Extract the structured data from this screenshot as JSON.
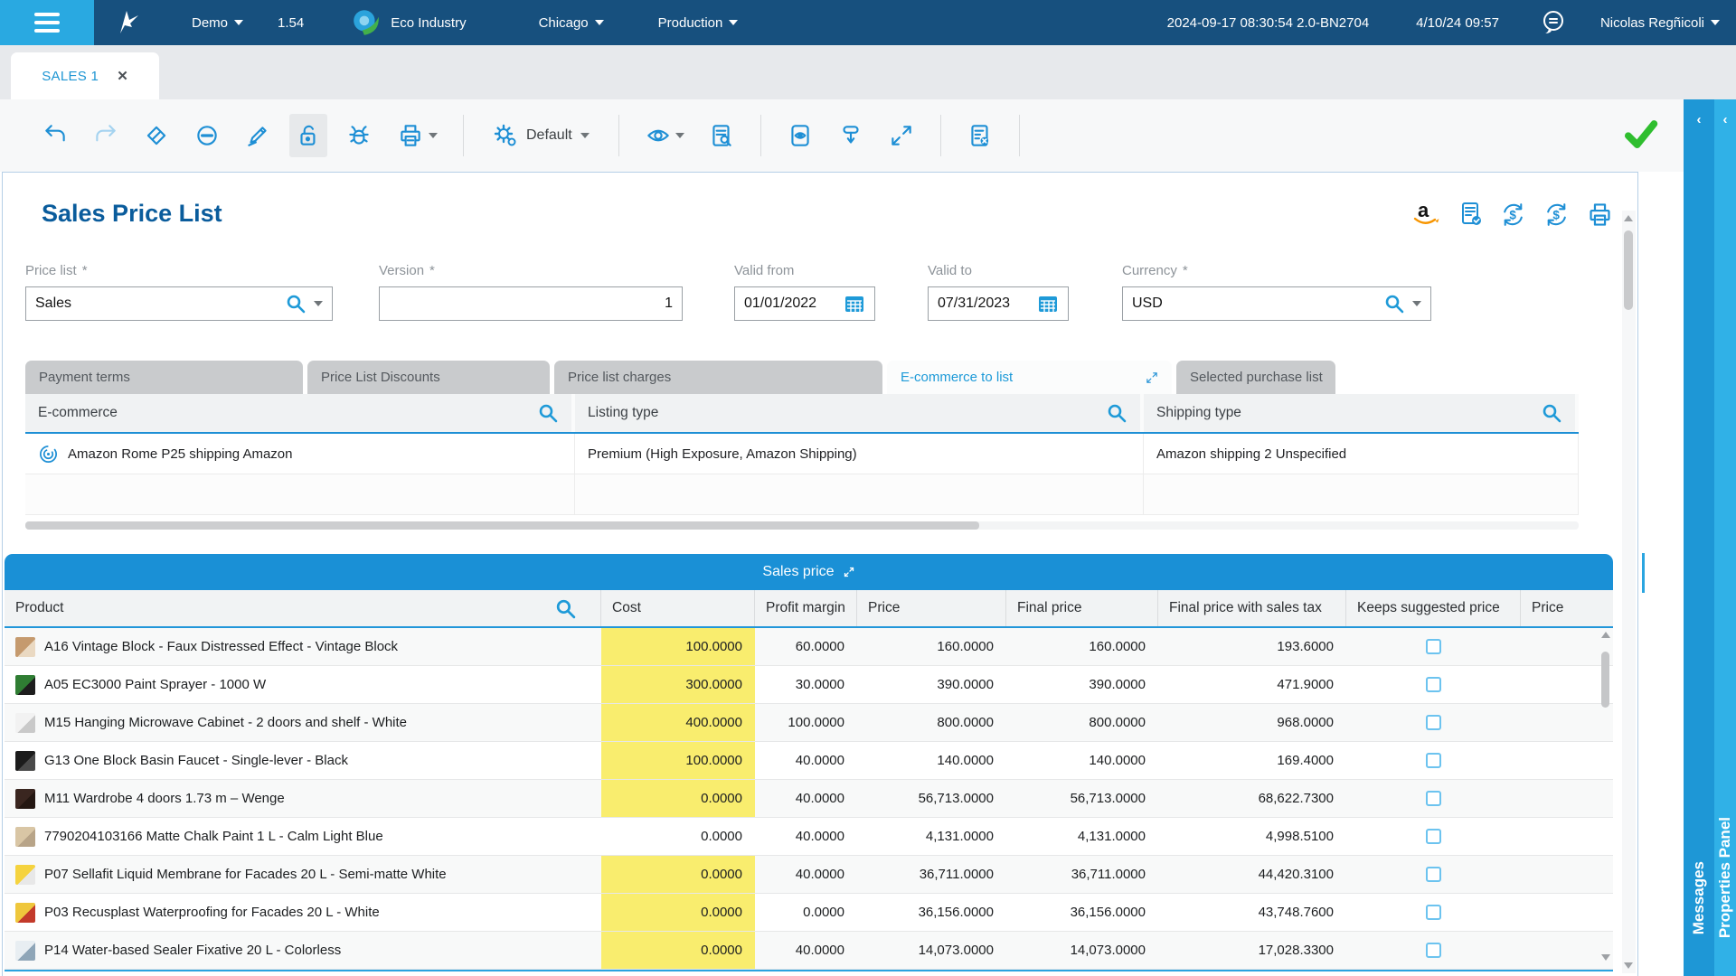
{
  "colors": {
    "accent_blue": "#1e8fd5",
    "topbar_navy": "#17507e",
    "light_blue": "#29a9e1",
    "highlight_yellow": "#f9ed6e",
    "success_green": "#2fbe2f",
    "amazon_orange": "#f79500"
  },
  "topbar": {
    "env": "Demo",
    "version": "1.54",
    "company": "Eco Industry",
    "branch": "Chicago",
    "mode": "Production",
    "build_info": "2024-09-17 08:30:54 2.0-BN2704",
    "session_time": "4/10/24 09:57",
    "user": "Nicolas Regñicoli"
  },
  "window_tab": {
    "label": "SALES 1",
    "close": "✕"
  },
  "toolbar": {
    "view_profile": "Default"
  },
  "page": {
    "title": "Sales Price List"
  },
  "form": {
    "price_list": {
      "label": "Price list",
      "required": "*",
      "value": "Sales"
    },
    "version": {
      "label": "Version",
      "required": "*",
      "value": "1"
    },
    "valid_from": {
      "label": "Valid from",
      "required": "",
      "value": "01/01/2022"
    },
    "valid_to": {
      "label": "Valid to",
      "required": "",
      "value": "07/31/2023"
    },
    "currency": {
      "label": "Currency",
      "required": "*",
      "value": "USD"
    }
  },
  "subtabs": [
    {
      "label": "Payment terms",
      "active": false
    },
    {
      "label": "Price List Discounts",
      "active": false
    },
    {
      "label": "Price list charges",
      "active": false
    },
    {
      "label": "E-commerce to list",
      "active": true
    },
    {
      "label": "Selected purchase list",
      "active": false
    }
  ],
  "ecommerce_table": {
    "columns": [
      "E-commerce",
      "Listing type",
      "Shipping type"
    ],
    "rows": [
      {
        "ecommerce": "Amazon Rome P25 shipping Amazon",
        "listing_type": "Premium (High Exposure, Amazon Shipping)",
        "shipping_type": "Amazon shipping 2 Unspecified"
      }
    ]
  },
  "sales_table": {
    "title": "Sales price",
    "columns": [
      "Product",
      "Cost",
      "Profit margin",
      "Price",
      "Final price",
      "Final price with sales tax",
      "Keeps suggested price",
      "Price"
    ],
    "rows": [
      {
        "product": "A16 Vintage Block - Faux Distressed Effect - Vintage Block",
        "cost": "100.0000",
        "profit_margin": "60.0000",
        "price": "160.0000",
        "final_price": "160.0000",
        "final_price_tax": "193.6000",
        "keeps_suggested": false,
        "cost_highlight": true,
        "thumb": [
          "#c59a6e",
          "#ead9c2"
        ]
      },
      {
        "product": "A05 EC3000 Paint Sprayer - 1000 W",
        "cost": "300.0000",
        "profit_margin": "30.0000",
        "price": "390.0000",
        "final_price": "390.0000",
        "final_price_tax": "471.9000",
        "keeps_suggested": false,
        "cost_highlight": true,
        "thumb": [
          "#2f7d33",
          "#1d1d1d"
        ]
      },
      {
        "product": "M15 Hanging Microwave Cabinet - 2 doors and shelf - White",
        "cost": "400.0000",
        "profit_margin": "100.0000",
        "price": "800.0000",
        "final_price": "800.0000",
        "final_price_tax": "968.0000",
        "keeps_suggested": false,
        "cost_highlight": true,
        "thumb": [
          "#f2f2f2",
          "#c9c9c9"
        ]
      },
      {
        "product": "G13 One Block Basin Faucet - Single-lever - Black",
        "cost": "100.0000",
        "profit_margin": "40.0000",
        "price": "140.0000",
        "final_price": "140.0000",
        "final_price_tax": "169.4000",
        "keeps_suggested": false,
        "cost_highlight": true,
        "thumb": [
          "#1c1c1c",
          "#4a4a4a"
        ]
      },
      {
        "product": "M11 Wardrobe 4 doors 1.73 m – Wenge",
        "cost": "0.0000",
        "profit_margin": "40.0000",
        "price": "56,713.0000",
        "final_price": "56,713.0000",
        "final_price_tax": "68,622.7300",
        "keeps_suggested": false,
        "cost_highlight": true,
        "thumb": [
          "#3a2620",
          "#241712"
        ]
      },
      {
        "product": "7790204103166 Matte Chalk Paint 1 L - Calm Light Blue",
        "cost": "0.0000",
        "profit_margin": "40.0000",
        "price": "4,131.0000",
        "final_price": "4,131.0000",
        "final_price_tax": "4,998.5100",
        "keeps_suggested": false,
        "cost_highlight": false,
        "thumb": [
          "#d9c6a5",
          "#b8a488"
        ]
      },
      {
        "product": "P07 Sellafit Liquid Membrane for Facades 20 L - Semi-matte White",
        "cost": "0.0000",
        "profit_margin": "40.0000",
        "price": "36,711.0000",
        "final_price": "36,711.0000",
        "final_price_tax": "44,420.3100",
        "keeps_suggested": false,
        "cost_highlight": true,
        "thumb": [
          "#f5d33f",
          "#e8e8e8"
        ]
      },
      {
        "product": "P03 Recusplast Waterproofing for Facades 20 L - White",
        "cost": "0.0000",
        "profit_margin": "0.0000",
        "price": "36,156.0000",
        "final_price": "36,156.0000",
        "final_price_tax": "43,748.7600",
        "keeps_suggested": false,
        "cost_highlight": true,
        "thumb": [
          "#efc73c",
          "#c33a2a"
        ]
      },
      {
        "product": "P14 Water-based Sealer Fixative 20 L - Colorless",
        "cost": "0.0000",
        "profit_margin": "40.0000",
        "price": "14,073.0000",
        "final_price": "14,073.0000",
        "final_price_tax": "17,028.3300",
        "keeps_suggested": false,
        "cost_highlight": true,
        "thumb": [
          "#e8eef2",
          "#8fa6b8"
        ]
      }
    ]
  },
  "side_panels": {
    "messages": "Messages",
    "properties": "Properties Panel"
  }
}
